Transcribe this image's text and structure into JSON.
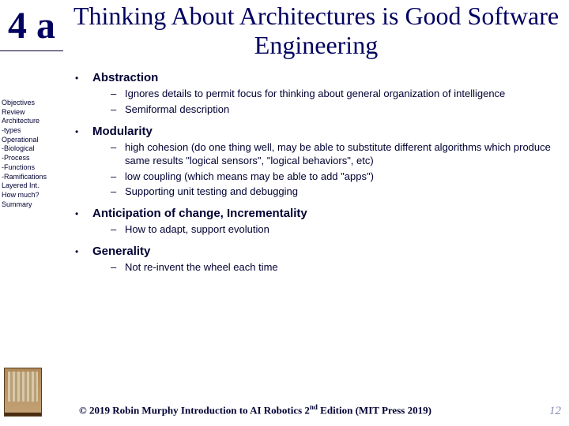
{
  "badge": "4 a",
  "title": "Thinking About Architectures is Good Software Engineering",
  "sidebar": [
    "Objectives",
    "Review",
    "Architecture",
    "-types",
    "Operational",
    "-Biological",
    "-Process",
    "-Functions",
    "-Ramifications",
    "Layered Int.",
    "How much?",
    "Summary"
  ],
  "bullets": [
    {
      "label": "Abstraction",
      "subs": [
        "Ignores details to permit focus for thinking about general organization of intelligence",
        "Semiformal description"
      ]
    },
    {
      "label": "Modularity",
      "subs": [
        "high cohesion (do one thing well, may be able to substitute different algorithms which produce same results \"logical sensors\", \"logical behaviors\", etc)",
        "low coupling (which means may be able to add \"apps\")",
        "Supporting unit testing and debugging"
      ]
    },
    {
      "label": "Anticipation of change, Incrementality",
      "subs": [
        "How to adapt, support evolution"
      ]
    },
    {
      "label": "Generality",
      "subs": [
        "Not re-invent the wheel each time"
      ]
    }
  ],
  "footer_prefix": "© 2019 Robin Murphy Introduction to AI Robotics 2",
  "footer_sup": "nd",
  "footer_suffix": " Edition (MIT Press 2019)",
  "page_number": "12"
}
